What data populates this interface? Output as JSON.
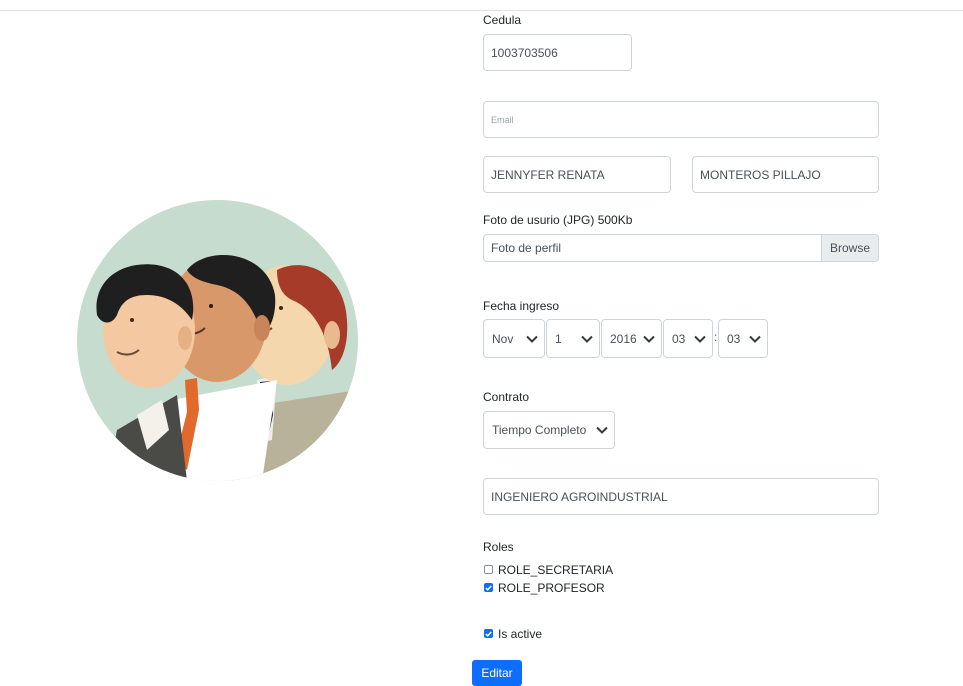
{
  "form": {
    "cedula_label": "Cedula",
    "cedula_value": "1003703506",
    "email_placeholder": "Email",
    "first_name_value": "JENNYFER RENATA",
    "last_name_value": "MONTEROS PILLAJO",
    "photo_label": "Foto de usurio (JPG) 500Kb",
    "photo_placeholder": "Foto de perfil",
    "browse_label": "Browse",
    "fecha_label": "Fecha ingreso",
    "fecha": {
      "month": "Nov",
      "day": "1",
      "year": "2016",
      "hour": "03",
      "minute": "03",
      "separator": ":"
    },
    "contrato_label": "Contrato",
    "contrato_value": "Tiempo Completo",
    "titulo_value": "INGENIERO AGROINDUSTRIAL",
    "roles_label": "Roles",
    "roles": [
      {
        "label": "ROLE_SECRETARIA",
        "checked": false
      },
      {
        "label": "ROLE_PROFESOR",
        "checked": true
      }
    ],
    "active_label": "Is active",
    "active_checked": true,
    "submit_label": "Editar"
  },
  "illustration": {
    "icon": "team-people-illustration",
    "colors": {
      "background_circle": "#c5dccf",
      "skin": "#f4c9a1",
      "dark_hair": "#1f1f1f",
      "red_hair": "#a63b2a",
      "orange_tie": "#e0692b",
      "navy_tie": "#1d2b4f",
      "jacket_gray": "#5a5a56",
      "jacket_khaki": "#b8b29a"
    }
  },
  "accent_color": "#0d6efd"
}
